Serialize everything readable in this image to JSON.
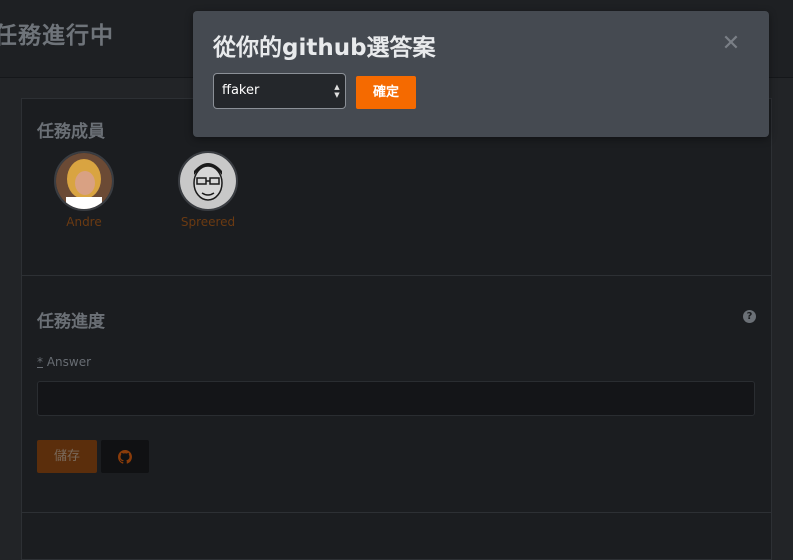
{
  "header": {
    "title": "任務進行中"
  },
  "members": {
    "title": "任務成員",
    "items": [
      {
        "name": "Andre"
      },
      {
        "name": "Spreered"
      }
    ]
  },
  "progress": {
    "title": "任務進度",
    "answer_label": "Answer",
    "required_mark": "*",
    "answer_value": "",
    "save_label": "儲存",
    "help_icon": "question-circle-icon",
    "github_icon": "github-icon"
  },
  "modal": {
    "title": "從你的github選答案",
    "close_icon": "close-icon",
    "select_value": "ffaker",
    "confirm_label": "確定"
  },
  "colors": {
    "accent": "#f56a00",
    "modal_bg": "#454a51",
    "page_bg": "#222427"
  }
}
